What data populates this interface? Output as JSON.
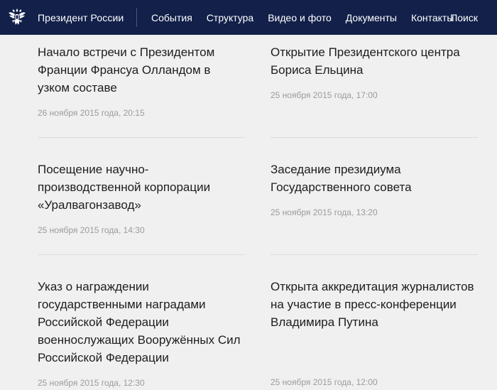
{
  "header": {
    "brand": "Президент России",
    "nav": [
      "События",
      "Структура",
      "Видео и фото",
      "Документы",
      "Контакты"
    ],
    "search": "Поиск"
  },
  "news": [
    {
      "title": "Начало встречи с Президентом Франции Франсуа Олландом в узком составе",
      "date": "26 ноября 2015 года, 20:15"
    },
    {
      "title": "Открытие Президентского центра Бориса Ельцина",
      "date": "25 ноября 2015 года, 17:00"
    },
    {
      "title": "Посещение научно-производственной корпорации «Уралвагонзавод»",
      "date": "25 ноября 2015 года, 14:30"
    },
    {
      "title": "Заседание президиума Государственного совета",
      "date": "25 ноября 2015 года, 13:20"
    },
    {
      "title": "Указ о награждении государственными наградами Российской Федерации военнослужащих Вооружённых Сил Российской Федерации",
      "date": "25 ноября 2015 года, 12:30"
    },
    {
      "title": "Открыта аккредитация журналистов на участие в пресс-конференции Владимира Путина",
      "date": "25 ноября 2015 года, 12:00"
    }
  ]
}
